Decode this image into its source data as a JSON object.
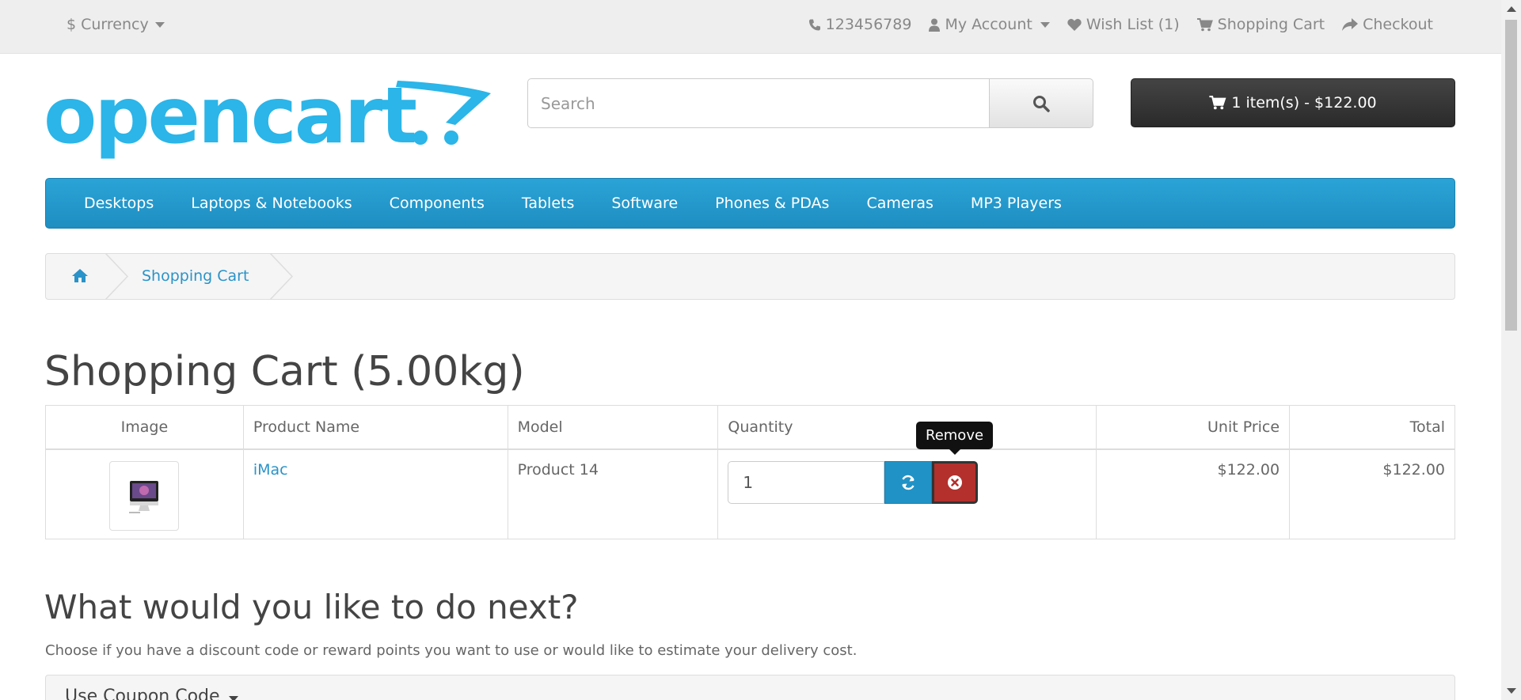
{
  "topbar": {
    "currency": "$ Currency",
    "phone": "123456789",
    "account": "My Account",
    "wishlist": "Wish List (1)",
    "cart": "Shopping Cart",
    "checkout": "Checkout"
  },
  "header": {
    "logo_text": "opencart",
    "search_placeholder": "Search",
    "cart_button": "1 item(s) - $122.00"
  },
  "menu": [
    "Desktops",
    "Laptops & Notebooks",
    "Components",
    "Tablets",
    "Software",
    "Phones & PDAs",
    "Cameras",
    "MP3 Players"
  ],
  "breadcrumb": {
    "current": "Shopping Cart"
  },
  "page": {
    "title": "Shopping Cart  (5.00kg)"
  },
  "cart_table": {
    "headers": [
      "Image",
      "Product Name",
      "Model",
      "Quantity",
      "Unit Price",
      "Total"
    ],
    "rows": [
      {
        "name": "iMac",
        "model": "Product 14",
        "quantity": "1",
        "unit_price": "$122.00",
        "total": "$122.00"
      }
    ],
    "remove_tooltip": "Remove"
  },
  "next": {
    "title": "What would you like to do next?",
    "text": "Choose if you have a discount code or reward points you want to use or would like to estimate your delivery cost.",
    "coupon_panel": "Use Coupon Code"
  },
  "colors": {
    "accent": "#2192c5",
    "danger": "#b3302d",
    "logo": "#2bb5e8"
  }
}
